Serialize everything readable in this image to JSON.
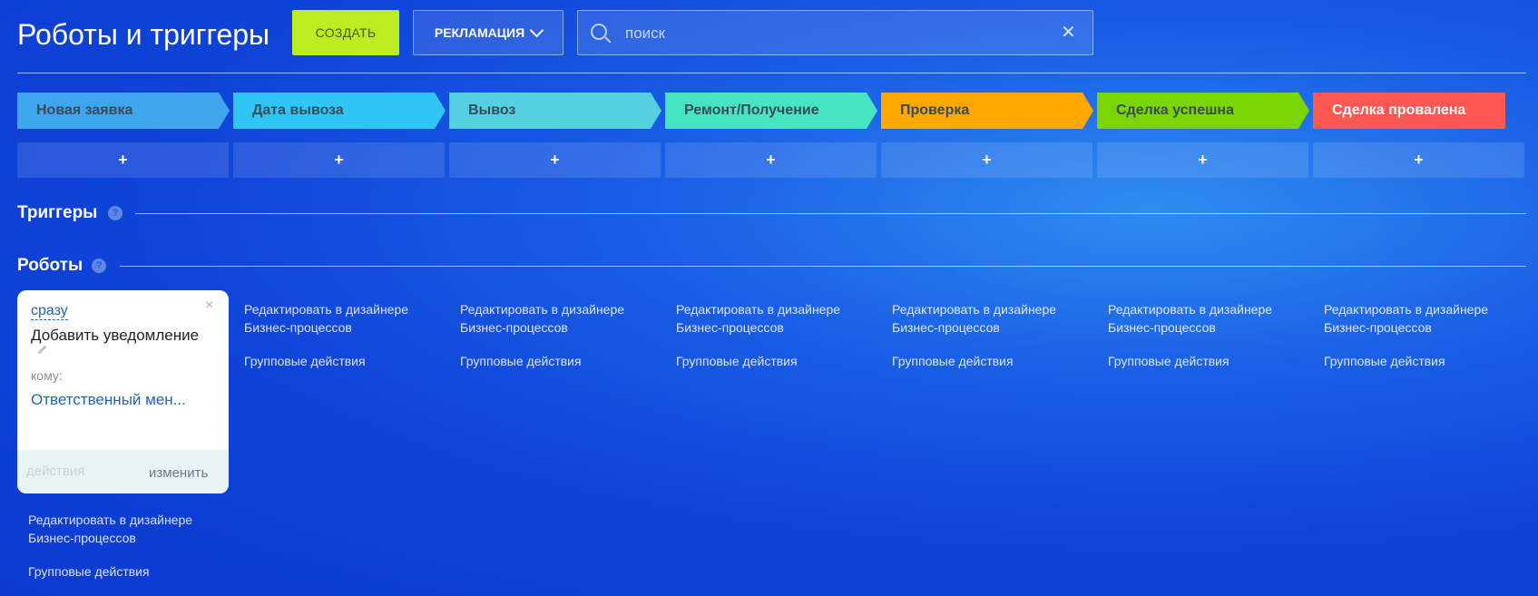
{
  "header": {
    "title": "Роботы и триггеры",
    "create_label": "Создать",
    "category_label": "Рекламация",
    "search": {
      "placeholder": "поиск",
      "value": ""
    }
  },
  "stages": [
    {
      "label": "Новая заявка",
      "color": "#3fa6ee",
      "text_color": "#3b4a5a"
    },
    {
      "label": "Дата вывоза",
      "color": "#2fc6f6",
      "text_color": "#3b4a5a"
    },
    {
      "label": "Вывоз",
      "color": "#55d0e0",
      "text_color": "#3b4a5a"
    },
    {
      "label": "Ремонт/Получение",
      "color": "#47e4c2",
      "text_color": "#3b4a5a"
    },
    {
      "label": "Проверка",
      "color": "#ffa900",
      "text_color": "#3b4a5a"
    },
    {
      "label": "Сделка успешна",
      "color": "#7bd500",
      "text_color": "#3b4a5a"
    },
    {
      "label": "Сделка провалена",
      "color": "#ff5752",
      "text_color": "#ffffff"
    }
  ],
  "add_label": "+",
  "triggers": {
    "label": "Триггеры",
    "help": "?"
  },
  "robots": {
    "label": "Роботы",
    "help": "?"
  },
  "robot_card": {
    "when": "сразу",
    "name": "Добавить уведомление",
    "to_label": "кому:",
    "recipient": "Ответственный мен...",
    "actions_label": "действия",
    "edit_label": "изменить",
    "close": "×"
  },
  "column_links": {
    "designer_line1": "Редактировать в дизайнере",
    "designer_line2": "Бизнес-процессов",
    "group_actions": "Групповые действия"
  },
  "icons": [
    "search-icon",
    "clear-icon",
    "chevron-down-icon",
    "help-icon",
    "close-icon",
    "pencil-icon"
  ]
}
